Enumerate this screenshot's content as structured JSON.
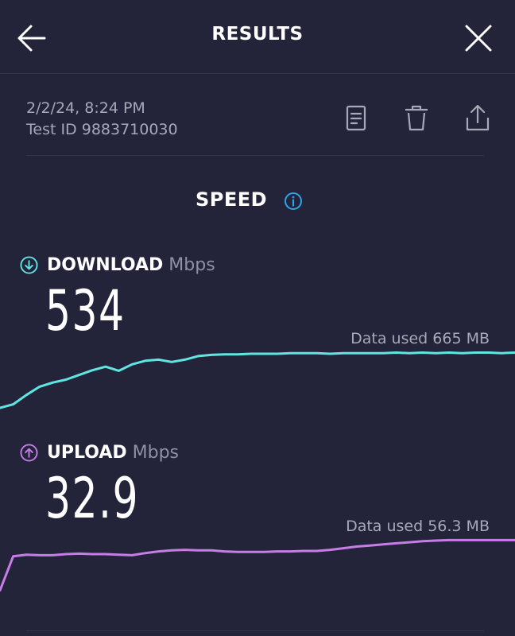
{
  "header": {
    "title": "RESULTS",
    "back_icon": "arrow-left-icon",
    "close_icon": "close-icon"
  },
  "test": {
    "datetime": "2/2/24, 8:24 PM",
    "test_id": "Test ID 9883710030",
    "actions": [
      "document-icon",
      "trash-icon",
      "share-icon"
    ]
  },
  "speed": {
    "title": "SPEED",
    "info_icon": "info-icon"
  },
  "download": {
    "label": "DOWNLOAD",
    "unit": "Mbps",
    "value": "534",
    "data_used": "Data used 665 MB",
    "color": "#5fe6e0",
    "icon": "download-arrow-icon",
    "trace": [
      0.04,
      0.1,
      0.26,
      0.4,
      0.47,
      0.52,
      0.6,
      0.68,
      0.74,
      0.67,
      0.78,
      0.84,
      0.86,
      0.82,
      0.86,
      0.92,
      0.94,
      0.95,
      0.95,
      0.96,
      0.96,
      0.96,
      0.97,
      0.97,
      0.97,
      0.96,
      0.97,
      0.97,
      0.97,
      0.97,
      0.98,
      0.97,
      0.98,
      0.97,
      0.98,
      0.97,
      0.98,
      0.98,
      0.97,
      0.98
    ]
  },
  "upload": {
    "label": "UPLOAD",
    "unit": "Mbps",
    "value": "32.9",
    "data_used": "Data used 56.3 MB",
    "color": "#c77de6",
    "icon": "upload-arrow-icon",
    "trace": [
      0.05,
      0.68,
      0.71,
      0.7,
      0.7,
      0.72,
      0.73,
      0.72,
      0.72,
      0.71,
      0.7,
      0.74,
      0.77,
      0.79,
      0.8,
      0.79,
      0.79,
      0.77,
      0.76,
      0.76,
      0.76,
      0.77,
      0.77,
      0.78,
      0.78,
      0.8,
      0.83,
      0.86,
      0.88,
      0.9,
      0.92,
      0.94,
      0.96,
      0.97,
      0.98,
      0.98,
      0.98,
      0.98,
      0.98,
      0.98
    ]
  },
  "colors": {
    "background": "#23233a",
    "divider": "#34344c",
    "muted_text": "#a7a9b8",
    "info_blue": "#2aa5e8"
  }
}
